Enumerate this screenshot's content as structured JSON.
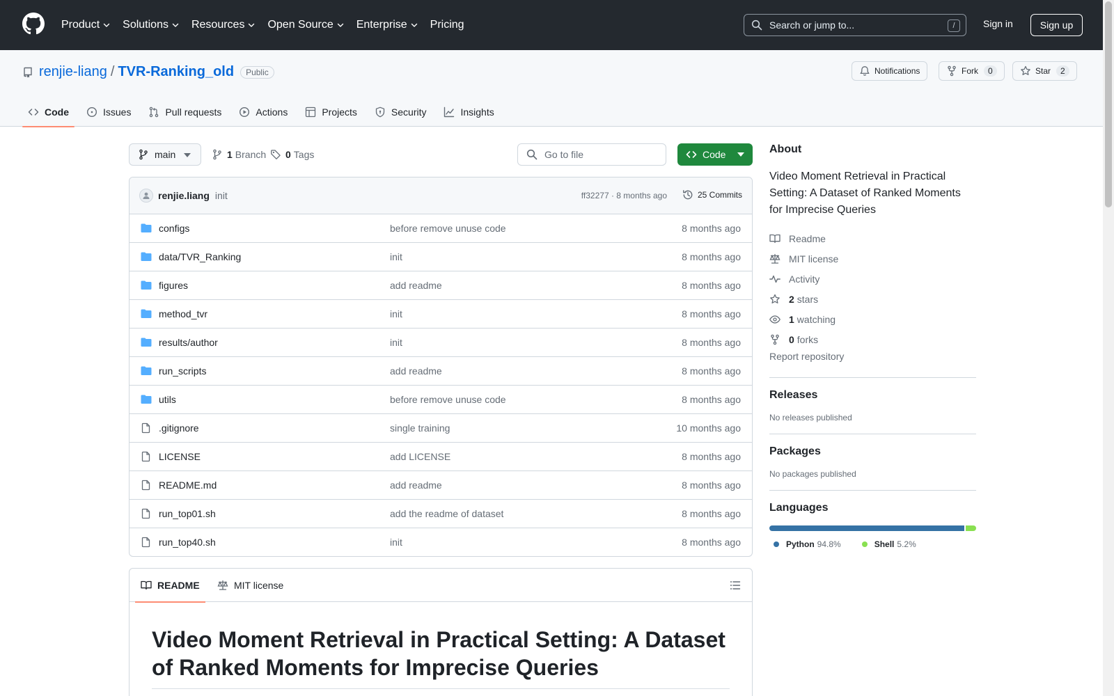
{
  "header": {
    "nav": [
      {
        "label": "Product",
        "dropdown": true
      },
      {
        "label": "Solutions",
        "dropdown": true
      },
      {
        "label": "Resources",
        "dropdown": true
      },
      {
        "label": "Open Source",
        "dropdown": true
      },
      {
        "label": "Enterprise",
        "dropdown": true
      },
      {
        "label": "Pricing",
        "dropdown": false
      }
    ],
    "search_placeholder": "Search or jump to...",
    "search_shortcut": "/",
    "sign_in": "Sign in",
    "sign_up": "Sign up"
  },
  "repo": {
    "owner": "renjie-liang",
    "separator": "/",
    "name": "TVR-Ranking_old",
    "visibility": "Public",
    "notifications_label": "Notifications",
    "fork_label": "Fork",
    "fork_count": "0",
    "star_label": "Star",
    "star_count": "2"
  },
  "tabs": [
    {
      "label": "Code",
      "icon": "code-icon",
      "active": true
    },
    {
      "label": "Issues",
      "icon": "issue-icon",
      "active": false
    },
    {
      "label": "Pull requests",
      "icon": "pull-request-icon",
      "active": false
    },
    {
      "label": "Actions",
      "icon": "play-icon",
      "active": false
    },
    {
      "label": "Projects",
      "icon": "table-icon",
      "active": false
    },
    {
      "label": "Security",
      "icon": "shield-icon",
      "active": false
    },
    {
      "label": "Insights",
      "icon": "graph-icon",
      "active": false
    }
  ],
  "toolbar": {
    "branch": "main",
    "branch_count": "1",
    "branch_label": "Branch",
    "tag_count": "0",
    "tag_label": "Tags",
    "go_to_file": "Go to file",
    "code_button": "Code"
  },
  "latest_commit": {
    "user": "renjie.liang",
    "message": "init",
    "hash_time": "ff32277 · 8 months ago",
    "commits": "25 Commits"
  },
  "files": [
    {
      "type": "folder",
      "name": "configs",
      "message": "before remove unuse code",
      "time": "8 months ago"
    },
    {
      "type": "folder",
      "name": "data/TVR_Ranking",
      "message": "init",
      "time": "8 months ago"
    },
    {
      "type": "folder",
      "name": "figures",
      "message": "add readme",
      "time": "8 months ago"
    },
    {
      "type": "folder",
      "name": "method_tvr",
      "message": "init",
      "time": "8 months ago"
    },
    {
      "type": "folder",
      "name": "results/author",
      "message": "init",
      "time": "8 months ago"
    },
    {
      "type": "folder",
      "name": "run_scripts",
      "message": "add readme",
      "time": "8 months ago"
    },
    {
      "type": "folder",
      "name": "utils",
      "message": "before remove unuse code",
      "time": "8 months ago"
    },
    {
      "type": "file",
      "name": ".gitignore",
      "message": "single training",
      "time": "10 months ago"
    },
    {
      "type": "file",
      "name": "LICENSE",
      "message": "add LICENSE",
      "time": "8 months ago"
    },
    {
      "type": "file",
      "name": "README.md",
      "message": "add readme",
      "time": "8 months ago"
    },
    {
      "type": "file",
      "name": "run_top01.sh",
      "message": "add the readme of dataset",
      "time": "8 months ago"
    },
    {
      "type": "file",
      "name": "run_top40.sh",
      "message": "init",
      "time": "8 months ago"
    }
  ],
  "readme": {
    "tab_readme": "README",
    "tab_license": "MIT license",
    "title": "Video Moment Retrieval in Practical Setting: A Dataset of Ranked Moments for Imprecise Queries"
  },
  "sidebar": {
    "about_title": "About",
    "description": "Video Moment Retrieval in Practical Setting: A Dataset of Ranked Moments for Imprecise Queries",
    "links": [
      {
        "icon": "book-icon",
        "count": "",
        "label": "Readme"
      },
      {
        "icon": "law-icon",
        "count": "",
        "label": "MIT license"
      },
      {
        "icon": "pulse-icon",
        "count": "",
        "label": "Activity"
      },
      {
        "icon": "star-icon",
        "count": "2",
        "label": "stars"
      },
      {
        "icon": "eye-icon",
        "count": "1",
        "label": "watching"
      },
      {
        "icon": "fork-icon",
        "count": "0",
        "label": "forks"
      }
    ],
    "report": "Report repository",
    "releases_title": "Releases",
    "releases_text": "No releases published",
    "packages_title": "Packages",
    "packages_text": "No packages published",
    "languages_title": "Languages",
    "languages": [
      {
        "name": "Python",
        "percent": "94.8%",
        "value": 94.8,
        "color": "#3572A5"
      },
      {
        "name": "Shell",
        "percent": "5.2%",
        "value": 5.2,
        "color": "#89e051"
      }
    ]
  },
  "colors": {
    "header_bg": "#24292f",
    "link": "#0969da",
    "accent_green": "#1f883d",
    "folder": "#54aeff",
    "tab_underline": "#fd8c73"
  }
}
